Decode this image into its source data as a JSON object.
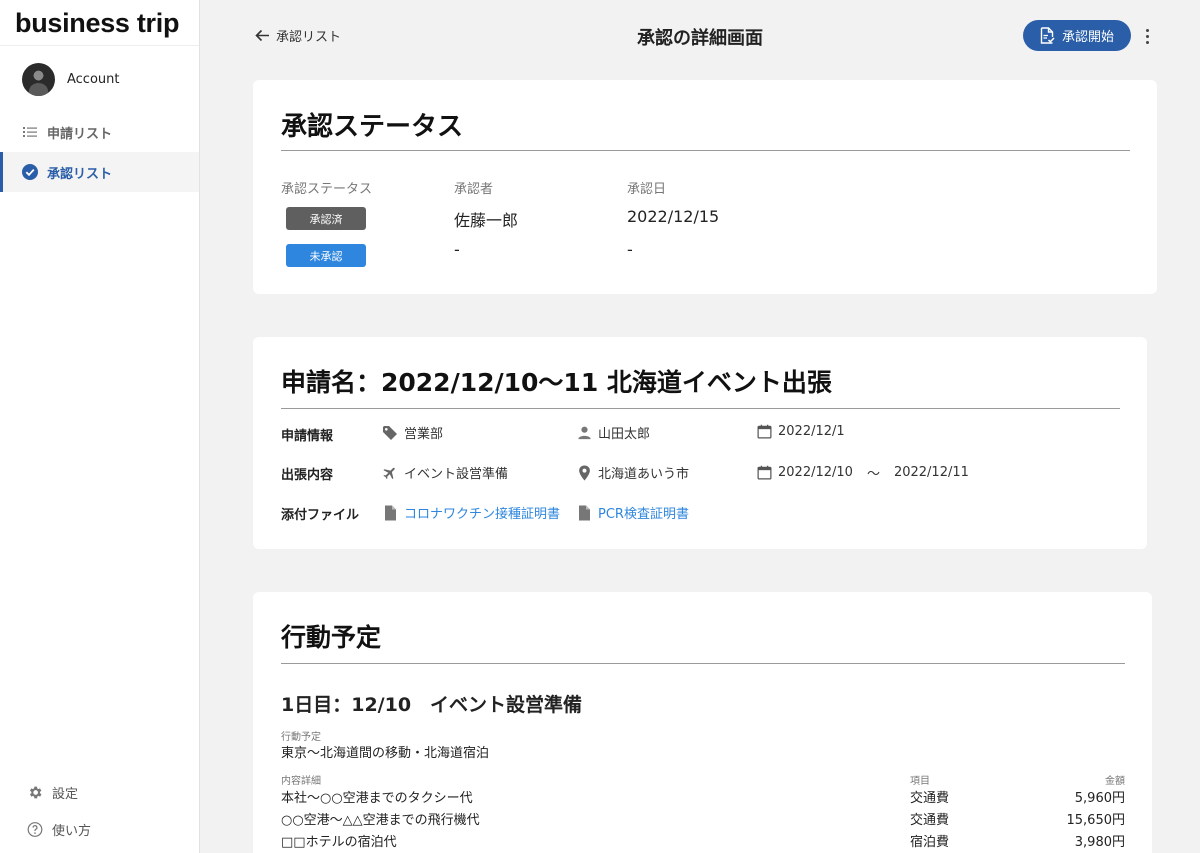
{
  "sidebar": {
    "brand": "business trip",
    "account": "Account",
    "items": [
      {
        "label": "申請リスト"
      },
      {
        "label": "承認リスト"
      }
    ],
    "bottom": [
      {
        "label": "設定"
      },
      {
        "label": "使い方"
      }
    ],
    "active_color": "#2a5ea8"
  },
  "topbar": {
    "back_label": "承認リスト",
    "title": "承認の詳細画面",
    "start_label": "承認開始"
  },
  "status": {
    "title": "承認ステータス",
    "headers": [
      "承認ステータス",
      "承認者",
      "承認日"
    ],
    "rows": [
      {
        "badge": "承認済",
        "badge_color": "#5f5f5f",
        "approver": "佐藤一郎",
        "date": "2022/12/15"
      },
      {
        "badge": "未承認",
        "badge_color": "#2e86de",
        "approver": "-",
        "date": "-"
      }
    ]
  },
  "application": {
    "title": "申請名：2022/12/10〜11 北海道イベント出張",
    "labels": {
      "info": "申請情報",
      "content": "出張内容",
      "attachments": "添付ファイル"
    },
    "info": {
      "department": "営業部",
      "applicant": "山田太郎",
      "date": "2022/12/1"
    },
    "content": {
      "purpose": "イベント設営準備",
      "place": "北海道あいう市",
      "start": "2022/12/10",
      "sep": "〜",
      "end": "2022/12/11"
    },
    "attachments": [
      "コロナワクチン接種証明書",
      "PCR検査証明書"
    ]
  },
  "schedule": {
    "title": "行動予定",
    "day_title": "1日目：12/10　イベント設営準備",
    "plan_label": "行動予定",
    "plan_text": "東京〜北海道間の移動・北海道宿泊",
    "detail_label": "内容詳細",
    "category_label": "項目",
    "amount_label": "金額",
    "details": [
      {
        "name": "本社〜○○空港までのタクシー代",
        "category": "交通費",
        "amount": "5,960円"
      },
      {
        "name": "○○空港〜△△空港までの飛行機代",
        "category": "交通費",
        "amount": "15,650円"
      },
      {
        "name": "□□ホテルの宿泊代",
        "category": "宿泊費",
        "amount": "3,980円"
      }
    ]
  }
}
